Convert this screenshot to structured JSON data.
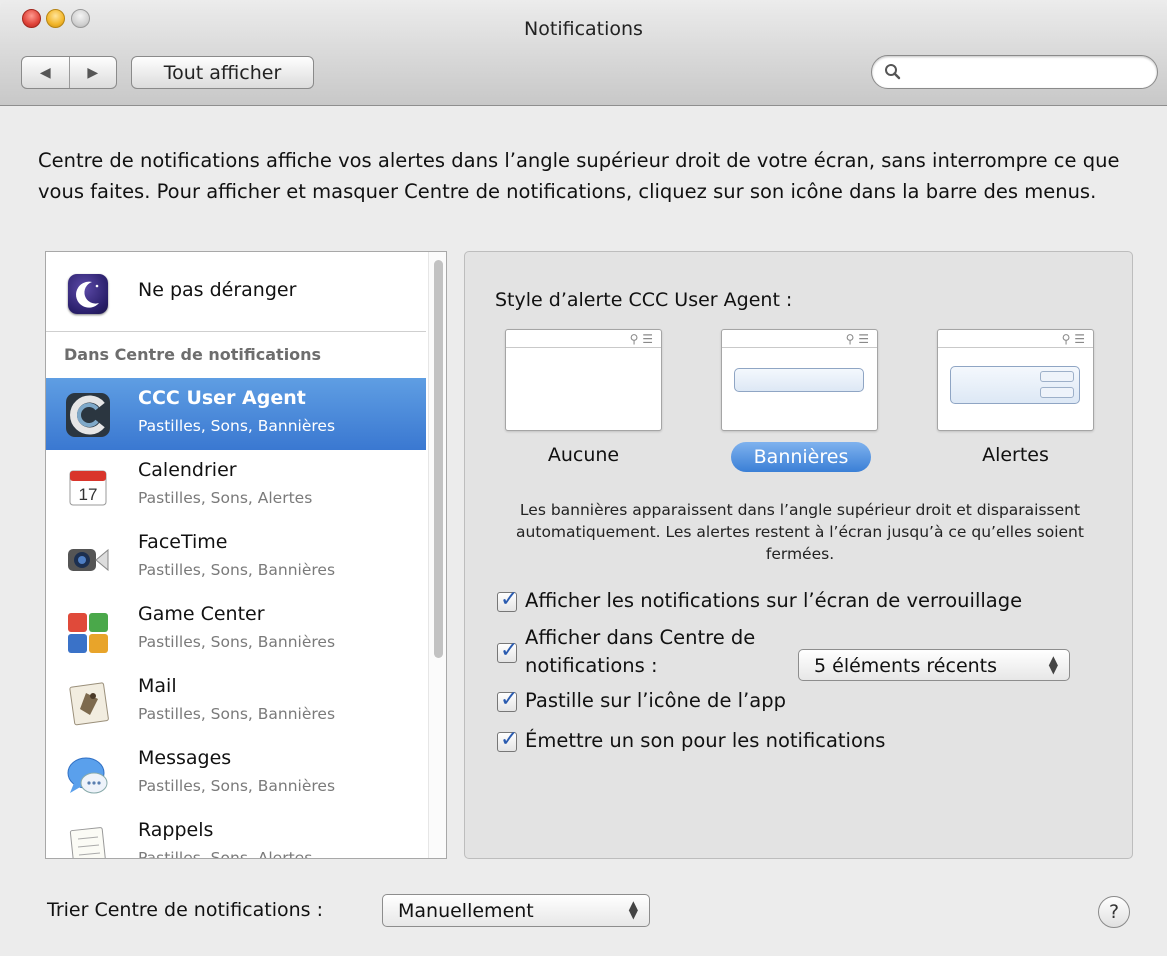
{
  "window": {
    "title": "Notifications",
    "show_all_label": "Tout afficher",
    "back_glyph": "◀",
    "forward_glyph": "▶",
    "search_placeholder": ""
  },
  "description": "Centre de notifications affiche vos alertes dans l’angle supérieur droit de votre écran, sans interrompre ce que vous faites. Pour afficher et masquer Centre de notifications, cliquez sur son icône dans la barre des menus.",
  "sidebar": {
    "do_not_disturb": {
      "label": "Ne pas déranger",
      "icon": "moon-icon"
    },
    "section_header": "Dans Centre de notifications",
    "apps": [
      {
        "name": "CCC User Agent",
        "sub": "Pastilles, Sons, Bannières",
        "icon": "ccc-icon",
        "selected": true
      },
      {
        "name": "Calendrier",
        "sub": "Pastilles, Sons, Alertes",
        "icon": "calendar-icon",
        "calendar_day": "17"
      },
      {
        "name": "FaceTime",
        "sub": "Pastilles, Sons, Bannières",
        "icon": "facetime-icon"
      },
      {
        "name": "Game Center",
        "sub": "Pastilles, Sons, Bannières",
        "icon": "game-center-icon"
      },
      {
        "name": "Mail",
        "sub": "Pastilles, Sons, Bannières",
        "icon": "mail-icon"
      },
      {
        "name": "Messages",
        "sub": "Pastilles, Sons, Bannières",
        "icon": "messages-icon"
      },
      {
        "name": "Rappels",
        "sub": "Pastilles, Sons, Alertes",
        "icon": "reminders-icon"
      }
    ]
  },
  "panel": {
    "style_label": "Style d’alerte CCC User Agent :",
    "styles": [
      {
        "label": "Aucune",
        "selected": false
      },
      {
        "label": "Bannières",
        "selected": true
      },
      {
        "label": "Alertes",
        "selected": false
      }
    ],
    "mini_toolbar_glyphs": "⚲ ☰",
    "info_text": "Les bannières apparaissent dans l’angle supérieur droit et disparaissent automatiquement. Les alertes restent à l’écran jusqu’à ce qu’elles soient fermées.",
    "checkboxes": {
      "lock_screen": {
        "label": "Afficher les notifications sur l’écran de verrouillage",
        "checked": true
      },
      "show_in_center_line1": "Afficher dans Centre de",
      "show_in_center_line2": "notifications :",
      "badge": {
        "label": "Pastille sur l’icône de l’app",
        "checked": true
      },
      "sound": {
        "label": "Émettre un son pour les notifications",
        "checked": true
      }
    },
    "recent_items_select": "5 éléments récents"
  },
  "bottom": {
    "sort_label": "Trier Centre de notifications :",
    "sort_select": "Manuellement",
    "help_label": "?"
  },
  "colors": {
    "selection": "#3a78d1",
    "accent_check": "#2a5bb0"
  }
}
